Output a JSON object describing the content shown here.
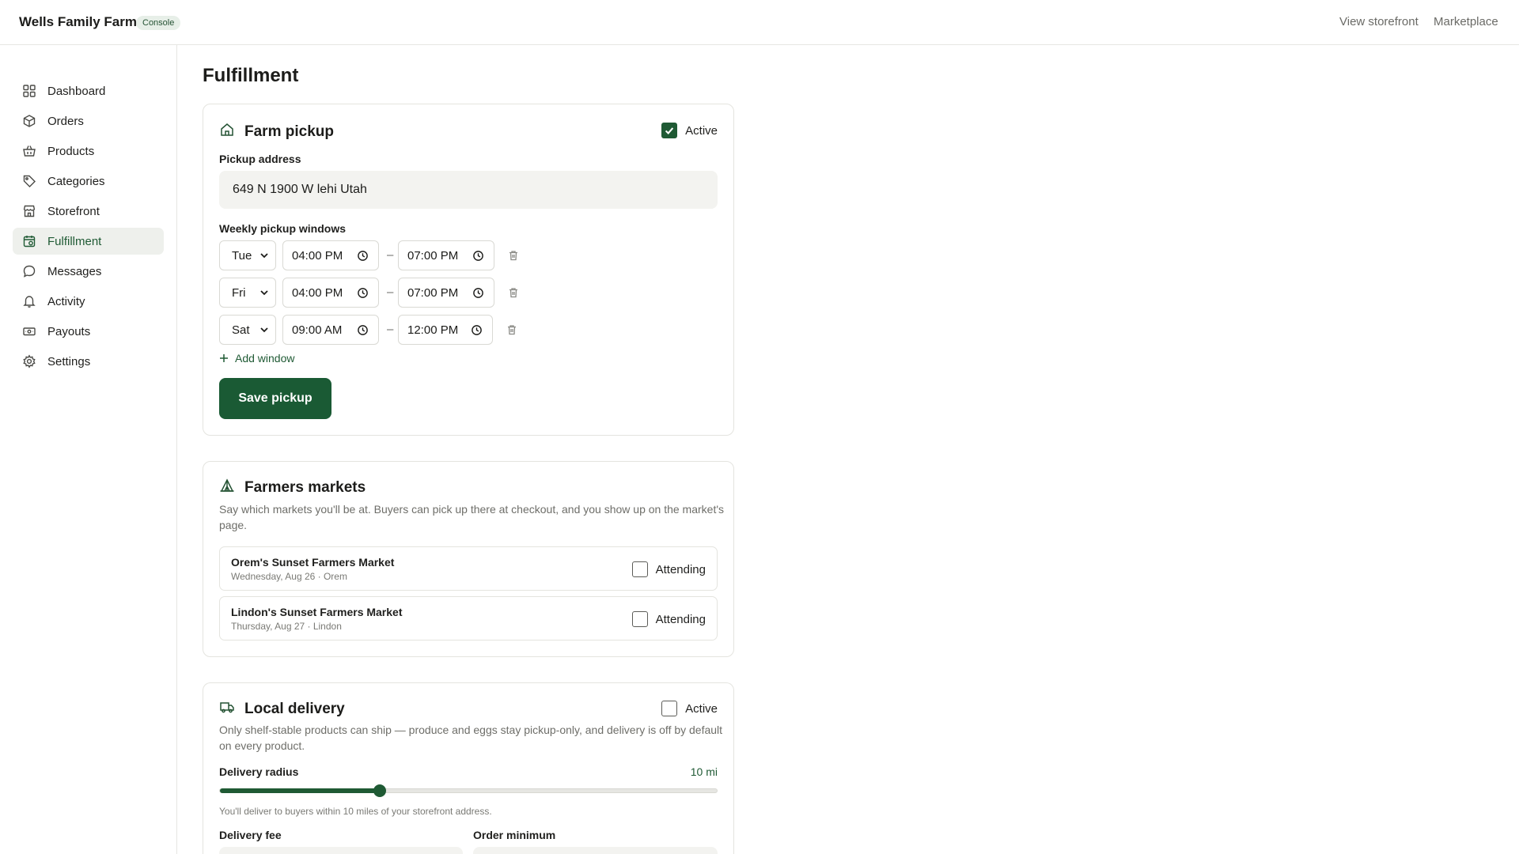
{
  "header": {
    "brand": "Wells Family Farm",
    "badge": "Console",
    "links": [
      "View storefront",
      "Marketplace"
    ]
  },
  "sidebar": {
    "items": [
      {
        "label": "Dashboard",
        "icon": "grid-icon"
      },
      {
        "label": "Orders",
        "icon": "box-icon"
      },
      {
        "label": "Products",
        "icon": "basket-icon"
      },
      {
        "label": "Categories",
        "icon": "tag-icon"
      },
      {
        "label": "Storefront",
        "icon": "store-icon"
      },
      {
        "label": "Fulfillment",
        "icon": "calendar-icon",
        "active": true
      },
      {
        "label": "Messages",
        "icon": "chat-icon"
      },
      {
        "label": "Activity",
        "icon": "bell-icon"
      },
      {
        "label": "Payouts",
        "icon": "cash-icon"
      },
      {
        "label": "Settings",
        "icon": "gear-icon"
      }
    ]
  },
  "page": {
    "title": "Fulfillment"
  },
  "pickup": {
    "title": "Farm pickup",
    "active_label": "Active",
    "active": true,
    "address_label": "Pickup address",
    "address_value": "649 N 1900 W lehi Utah",
    "windows_label": "Weekly pickup windows",
    "windows": [
      {
        "day": "Tue",
        "start": "04:00 PM",
        "end": "07:00 PM"
      },
      {
        "day": "Fri",
        "start": "04:00 PM",
        "end": "07:00 PM"
      },
      {
        "day": "Sat",
        "start": "09:00 AM",
        "end": "12:00 PM"
      }
    ],
    "dash": "–",
    "add_window": "Add window",
    "save": "Save pickup"
  },
  "markets": {
    "title": "Farmers markets",
    "description": "Say which markets you'll be at. Buyers can pick up there at checkout, and you show up on the market's page.",
    "items": [
      {
        "name": "Orem's Sunset Farmers Market",
        "sub": "Wednesday, Aug 26 · Orem",
        "attending_label": "Attending",
        "attending": false
      },
      {
        "name": "Lindon's Sunset Farmers Market",
        "sub": "Thursday, Aug 27 · Lindon",
        "attending_label": "Attending",
        "attending": false
      }
    ]
  },
  "delivery": {
    "title": "Local delivery",
    "active_label": "Active",
    "active": false,
    "description": "Only shelf-stable products can ship — produce and eggs stay pickup-only, and delivery is off by default on every product.",
    "radius_label": "Delivery radius",
    "radius_value": "10 mi",
    "radius_fraction": 0.32,
    "radius_hint": "You'll deliver to buyers within 10 miles of your storefront address.",
    "fee_label": "Delivery fee",
    "minimum_label": "Order minimum"
  },
  "colors": {
    "accent": "#1a5a34",
    "active_nav_bg": "#eef0ec"
  }
}
